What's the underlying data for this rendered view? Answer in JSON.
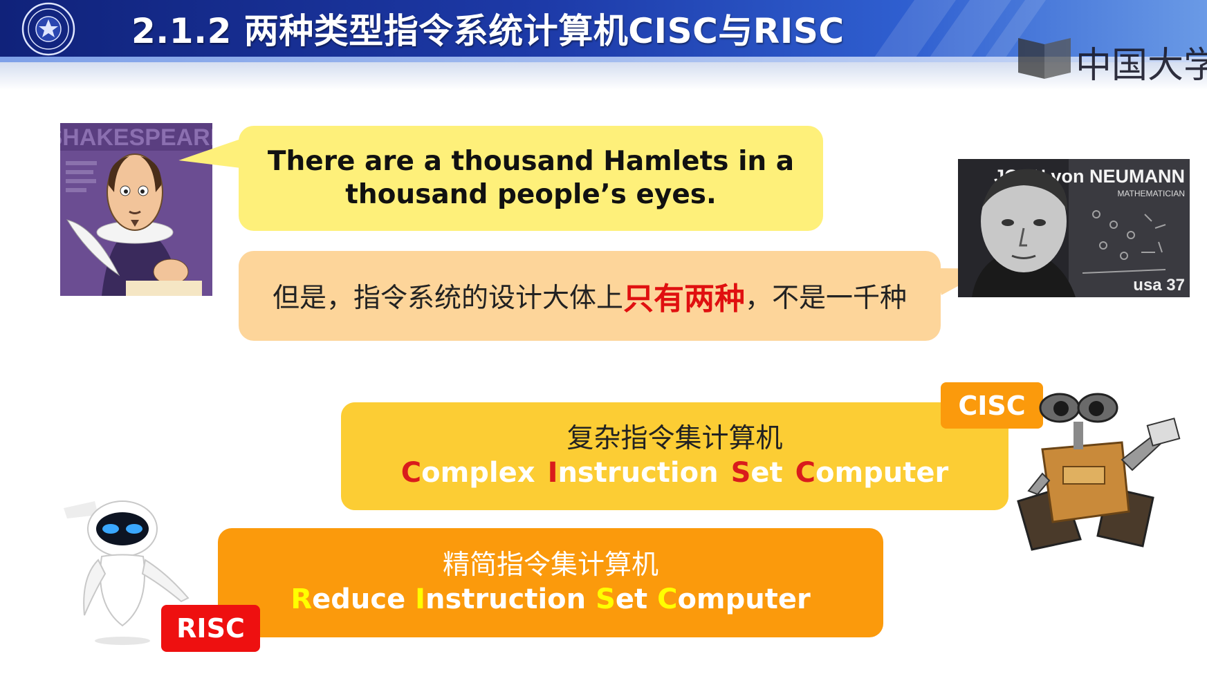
{
  "header": {
    "title": "2.1.2 两种类型指令系统计算机CISC与RISC",
    "watermark": "中国大学"
  },
  "bubbles": {
    "quote_line1": "There are a thousand Hamlets in a",
    "quote_line2": "thousand people’s eyes.",
    "cn_before": "但是，指令系统的设计大体上",
    "cn_highlight": "只有两种",
    "cn_after": "，不是一千种"
  },
  "portraits": {
    "shakespeare_label": "SHAKESPEARE",
    "neumann_label": "JOHN von NEUMANN",
    "neumann_sub": "MATHEMATICIAN",
    "neumann_stamp": "usa 37"
  },
  "cisc": {
    "tag": "CISC",
    "cn": "复杂指令集计算机",
    "words": [
      {
        "cap": "C",
        "rest": "omplex"
      },
      {
        "cap": "I",
        "rest": "nstruction"
      },
      {
        "cap": "S",
        "rest": "et"
      },
      {
        "cap": "C",
        "rest": "omputer"
      }
    ]
  },
  "risc": {
    "tag": "RISC",
    "cn": "精简指令集计算机",
    "words": [
      {
        "cap": "R",
        "rest": "educe"
      },
      {
        "cap": "I",
        "rest": "nstruction"
      },
      {
        "cap": "S",
        "rest": "et"
      },
      {
        "cap": "C",
        "rest": "omputer"
      }
    ]
  },
  "colors": {
    "header": "#1d3aa8",
    "quote_bubble": "#fef07a",
    "cn_bubble": "#fdd59a",
    "cisc_box": "#fccd34",
    "risc_box": "#fb9a0c",
    "highlight_red": "#e01010",
    "risc_tag": "#ee1010"
  }
}
